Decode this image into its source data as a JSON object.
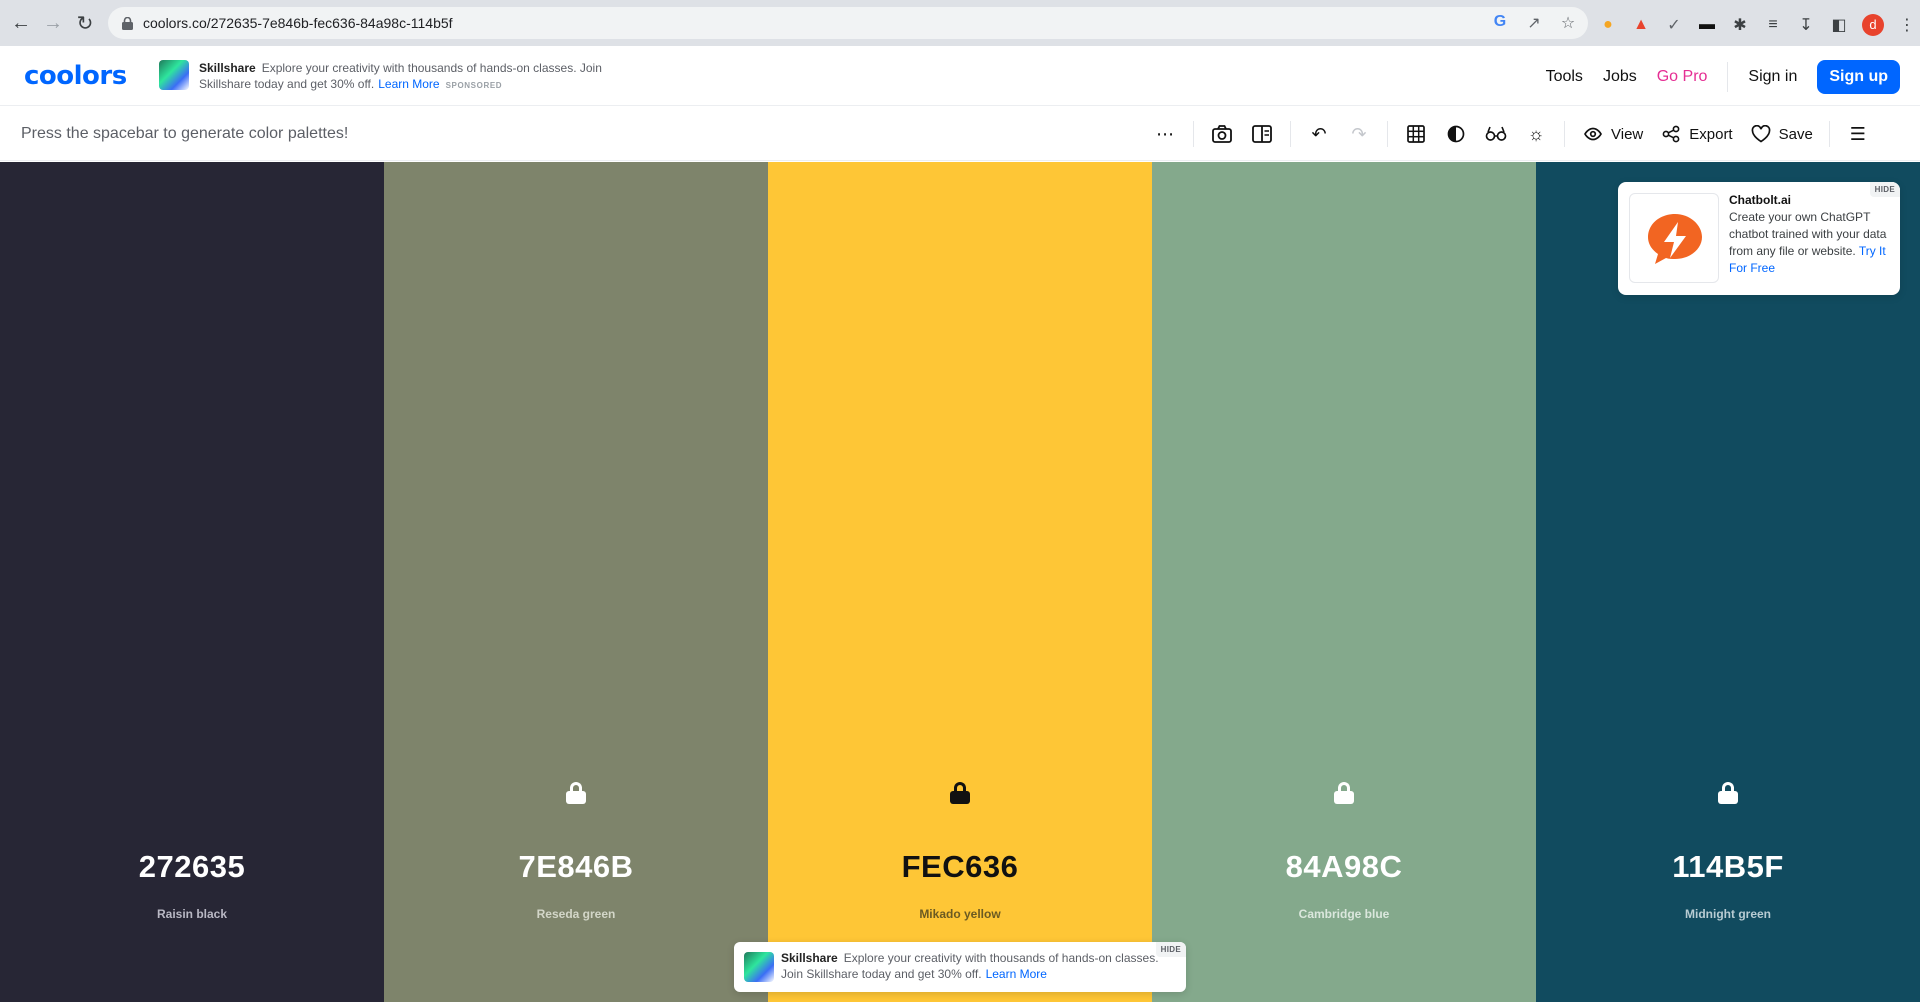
{
  "browser": {
    "url": "coolors.co/272635-7e846b-fec636-84a98c-114b5f",
    "avatar_letter": "d"
  },
  "header": {
    "logo_text": "coolors",
    "ad": {
      "brand": "Skillshare",
      "text": "Explore your creativity with thousands of hands-on classes. Join Skillshare today and get 30% off.",
      "link": "Learn More",
      "sponsored": "SPONSORED"
    },
    "nav": {
      "tools": "Tools",
      "jobs": "Jobs",
      "gopro": "Go Pro",
      "signin": "Sign in",
      "signup": "Sign up"
    }
  },
  "toolbar": {
    "hint": "Press the spacebar to generate color palettes!",
    "view_label": "View",
    "export_label": "Export",
    "save_label": "Save"
  },
  "palette": {
    "colors": [
      {
        "hex": "272635",
        "name": "Raisin black",
        "bg": "#272635",
        "text_color": "#ffffff",
        "sub_color": "#b9b8c4",
        "locked": false
      },
      {
        "hex": "7E846B",
        "name": "Reseda green",
        "bg": "#7e846b",
        "text_color": "#ffffff",
        "sub_color": "#d3d6c8",
        "locked": true
      },
      {
        "hex": "FEC636",
        "name": "Mikado yellow",
        "bg": "#fec636",
        "text_color": "#111111",
        "sub_color": "#6b5a22",
        "locked": true
      },
      {
        "hex": "84A98C",
        "name": "Cambridge blue",
        "bg": "#84a98c",
        "text_color": "#ffffff",
        "sub_color": "#dbe7dd",
        "locked": true
      },
      {
        "hex": "114B5F",
        "name": "Midnight green",
        "bg": "#114b5f",
        "text_color": "#ffffff",
        "sub_color": "#b8ccd3",
        "locked": true
      }
    ]
  },
  "ad_chatbolt": {
    "title": "Chatbolt.ai",
    "text": "Create your own ChatGPT chatbot trained with your data from any file or website.",
    "link": "Try It For Free",
    "hide": "HIDE",
    "brand_color": "#f26522"
  },
  "ad_bottom": {
    "brand": "Skillshare",
    "text": "Explore your creativity with thousands of hands-on classes. Join Skillshare today and get 30% off.",
    "link": "Learn More",
    "hide": "HIDE"
  }
}
